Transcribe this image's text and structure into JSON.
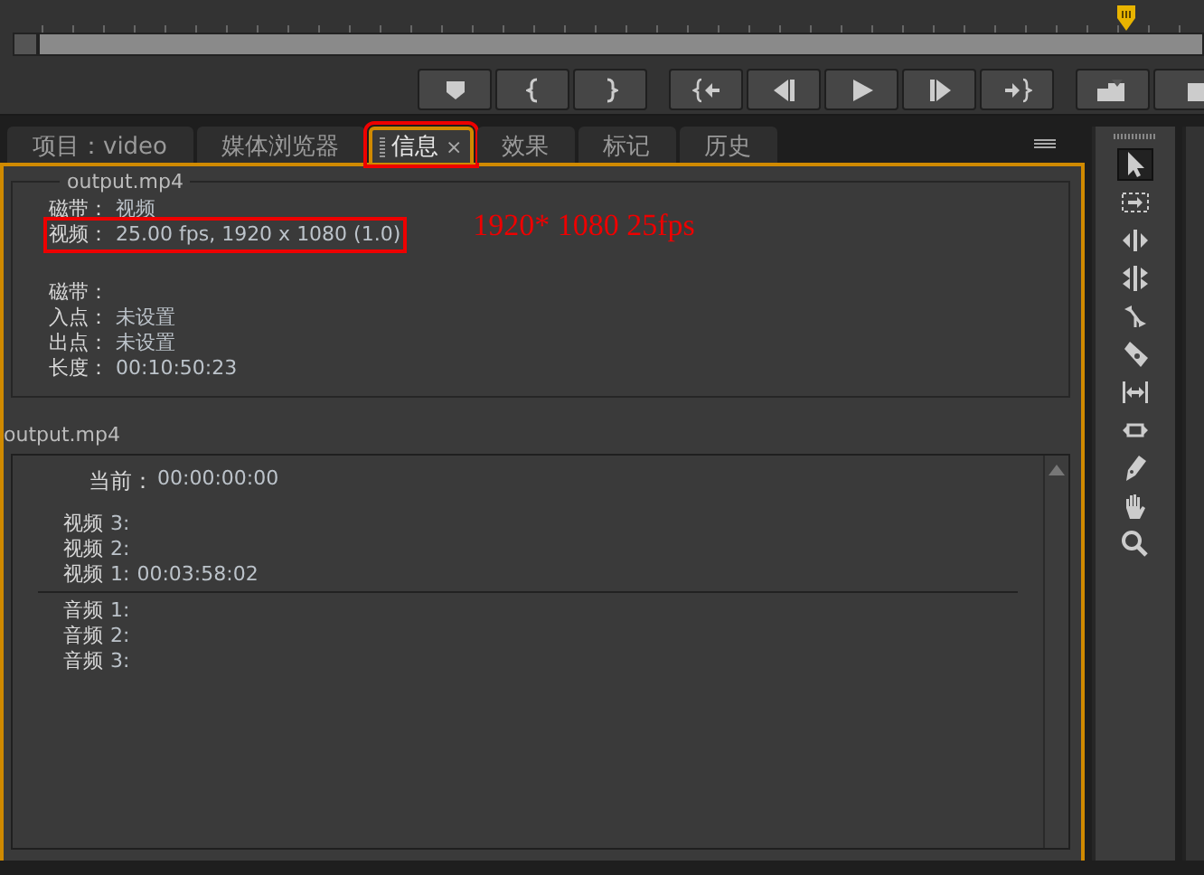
{
  "tabs": [
    {
      "label": "项目：video",
      "selected": false,
      "highlighted": false
    },
    {
      "label": "媒体浏览器",
      "selected": false,
      "highlighted": false
    },
    {
      "label": "信息",
      "selected": true,
      "highlighted": true,
      "close": "×"
    },
    {
      "label": "效果",
      "selected": false,
      "highlighted": false
    },
    {
      "label": "标记",
      "selected": false,
      "highlighted": false
    },
    {
      "label": "历史",
      "selected": false,
      "highlighted": false
    }
  ],
  "clip_info": {
    "title": "output.mp4",
    "groups": [
      [
        {
          "label": "磁带：",
          "value": "视频",
          "highlighted": false
        },
        {
          "label": "视频：",
          "value": "25.00 fps, 1920 x 1080 (1.0)",
          "highlighted": true
        }
      ],
      [
        {
          "label": "磁带：",
          "highlighted": false
        },
        {
          "label": "入点：",
          "value": "未设置",
          "highlighted": false
        },
        {
          "label": "出点：",
          "value": "未设置",
          "highlighted": false
        },
        {
          "label": "长度：",
          "value": "00:10:50:23",
          "highlighted": false
        }
      ]
    ]
  },
  "annotation_note": "1920* 1080 25fps",
  "sequence_info": {
    "title": "output.mp4",
    "current": {
      "label": "当前：",
      "value": "00:00:00:00"
    },
    "video_tracks": [
      {
        "label": "视频",
        "track": "3:"
      },
      {
        "label": "视频",
        "track": "2:"
      },
      {
        "label": "视频",
        "track": "1:",
        "value": "00:03:58:02"
      }
    ],
    "audio_tracks": [
      {
        "label": "音频",
        "track": "1:"
      },
      {
        "label": "音频",
        "track": "2:"
      },
      {
        "label": "音频",
        "track": "3:"
      }
    ]
  },
  "tools": [
    {
      "selected": true
    },
    {
      "selected": false
    },
    {
      "selected": false
    },
    {
      "selected": false
    },
    {
      "selected": false
    },
    {
      "selected": false
    },
    {
      "selected": false
    },
    {
      "selected": false
    },
    {
      "selected": false
    },
    {
      "selected": false
    },
    {
      "selected": false
    }
  ]
}
